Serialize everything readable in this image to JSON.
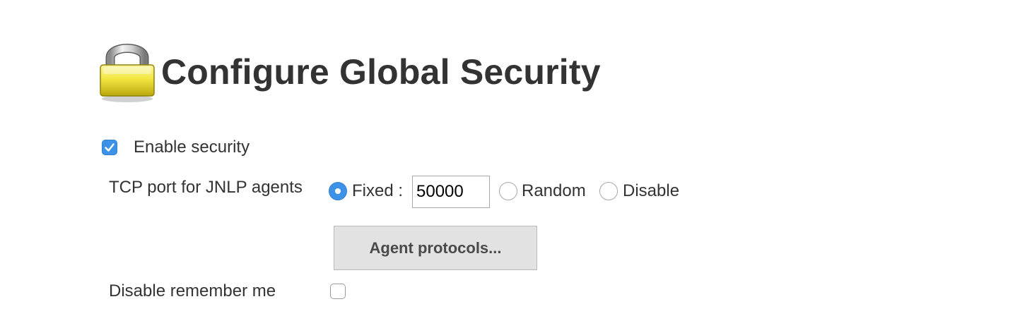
{
  "header": {
    "title": "Configure Global Security",
    "icon": "lock-icon"
  },
  "security": {
    "enable_label": "Enable security",
    "enabled": true
  },
  "tcp_port": {
    "label": "TCP port for JNLP agents",
    "selected": "fixed",
    "options": {
      "fixed": "Fixed :",
      "random": "Random",
      "disable": "Disable"
    },
    "port_value": "50000"
  },
  "agent_protocols": {
    "button_label": "Agent protocols..."
  },
  "remember_me": {
    "label": "Disable remember me",
    "checked": false
  },
  "colors": {
    "accent": "#3d92e8",
    "text": "#333333",
    "button_bg": "#e2e2e2",
    "lock_body": "#f2e640"
  }
}
